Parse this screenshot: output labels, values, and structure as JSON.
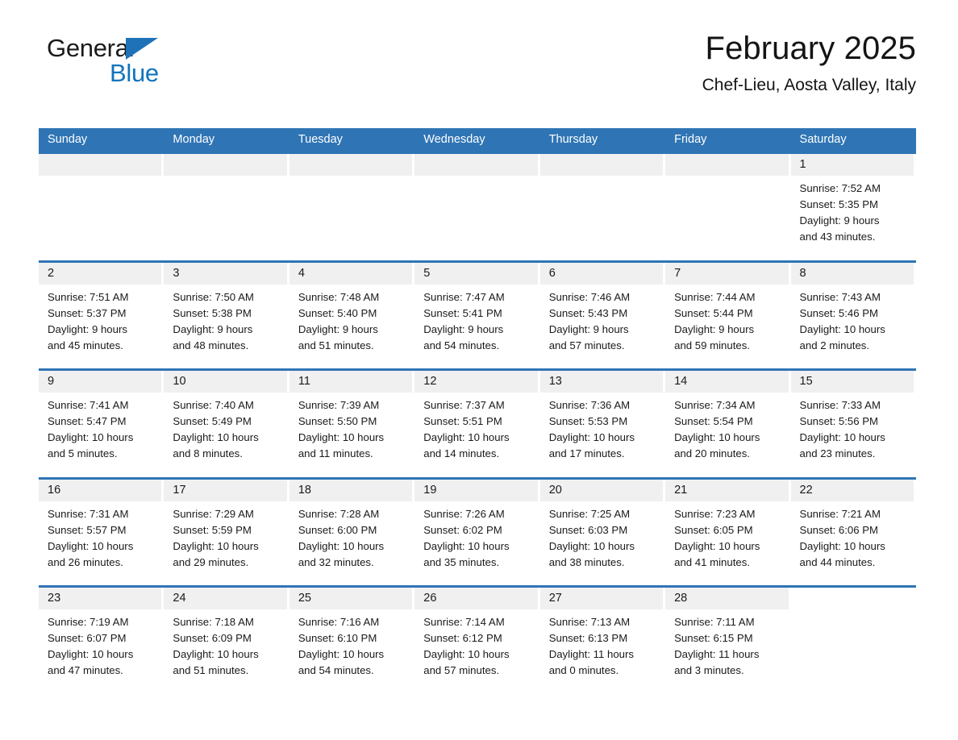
{
  "brand": {
    "name_part1": "General",
    "name_part2": "Blue",
    "triangle_color": "#1f72b8",
    "blue_color": "#1274bd"
  },
  "header": {
    "title": "February 2025",
    "subtitle": "Chef-Lieu, Aosta Valley, Italy",
    "accent_color": "#2f75b5",
    "band_color": "#f0f0f0"
  },
  "weekdays": [
    "Sunday",
    "Monday",
    "Tuesday",
    "Wednesday",
    "Thursday",
    "Friday",
    "Saturday"
  ],
  "weeks": [
    [
      {
        "day": "",
        "sunrise": "",
        "sunset": "",
        "daylight_1": "",
        "daylight_2": ""
      },
      {
        "day": "",
        "sunrise": "",
        "sunset": "",
        "daylight_1": "",
        "daylight_2": ""
      },
      {
        "day": "",
        "sunrise": "",
        "sunset": "",
        "daylight_1": "",
        "daylight_2": ""
      },
      {
        "day": "",
        "sunrise": "",
        "sunset": "",
        "daylight_1": "",
        "daylight_2": ""
      },
      {
        "day": "",
        "sunrise": "",
        "sunset": "",
        "daylight_1": "",
        "daylight_2": ""
      },
      {
        "day": "",
        "sunrise": "",
        "sunset": "",
        "daylight_1": "",
        "daylight_2": ""
      },
      {
        "day": "1",
        "sunrise": "Sunrise: 7:52 AM",
        "sunset": "Sunset: 5:35 PM",
        "daylight_1": "Daylight: 9 hours",
        "daylight_2": "and 43 minutes."
      }
    ],
    [
      {
        "day": "2",
        "sunrise": "Sunrise: 7:51 AM",
        "sunset": "Sunset: 5:37 PM",
        "daylight_1": "Daylight: 9 hours",
        "daylight_2": "and 45 minutes."
      },
      {
        "day": "3",
        "sunrise": "Sunrise: 7:50 AM",
        "sunset": "Sunset: 5:38 PM",
        "daylight_1": "Daylight: 9 hours",
        "daylight_2": "and 48 minutes."
      },
      {
        "day": "4",
        "sunrise": "Sunrise: 7:48 AM",
        "sunset": "Sunset: 5:40 PM",
        "daylight_1": "Daylight: 9 hours",
        "daylight_2": "and 51 minutes."
      },
      {
        "day": "5",
        "sunrise": "Sunrise: 7:47 AM",
        "sunset": "Sunset: 5:41 PM",
        "daylight_1": "Daylight: 9 hours",
        "daylight_2": "and 54 minutes."
      },
      {
        "day": "6",
        "sunrise": "Sunrise: 7:46 AM",
        "sunset": "Sunset: 5:43 PM",
        "daylight_1": "Daylight: 9 hours",
        "daylight_2": "and 57 minutes."
      },
      {
        "day": "7",
        "sunrise": "Sunrise: 7:44 AM",
        "sunset": "Sunset: 5:44 PM",
        "daylight_1": "Daylight: 9 hours",
        "daylight_2": "and 59 minutes."
      },
      {
        "day": "8",
        "sunrise": "Sunrise: 7:43 AM",
        "sunset": "Sunset: 5:46 PM",
        "daylight_1": "Daylight: 10 hours",
        "daylight_2": "and 2 minutes."
      }
    ],
    [
      {
        "day": "9",
        "sunrise": "Sunrise: 7:41 AM",
        "sunset": "Sunset: 5:47 PM",
        "daylight_1": "Daylight: 10 hours",
        "daylight_2": "and 5 minutes."
      },
      {
        "day": "10",
        "sunrise": "Sunrise: 7:40 AM",
        "sunset": "Sunset: 5:49 PM",
        "daylight_1": "Daylight: 10 hours",
        "daylight_2": "and 8 minutes."
      },
      {
        "day": "11",
        "sunrise": "Sunrise: 7:39 AM",
        "sunset": "Sunset: 5:50 PM",
        "daylight_1": "Daylight: 10 hours",
        "daylight_2": "and 11 minutes."
      },
      {
        "day": "12",
        "sunrise": "Sunrise: 7:37 AM",
        "sunset": "Sunset: 5:51 PM",
        "daylight_1": "Daylight: 10 hours",
        "daylight_2": "and 14 minutes."
      },
      {
        "day": "13",
        "sunrise": "Sunrise: 7:36 AM",
        "sunset": "Sunset: 5:53 PM",
        "daylight_1": "Daylight: 10 hours",
        "daylight_2": "and 17 minutes."
      },
      {
        "day": "14",
        "sunrise": "Sunrise: 7:34 AM",
        "sunset": "Sunset: 5:54 PM",
        "daylight_1": "Daylight: 10 hours",
        "daylight_2": "and 20 minutes."
      },
      {
        "day": "15",
        "sunrise": "Sunrise: 7:33 AM",
        "sunset": "Sunset: 5:56 PM",
        "daylight_1": "Daylight: 10 hours",
        "daylight_2": "and 23 minutes."
      }
    ],
    [
      {
        "day": "16",
        "sunrise": "Sunrise: 7:31 AM",
        "sunset": "Sunset: 5:57 PM",
        "daylight_1": "Daylight: 10 hours",
        "daylight_2": "and 26 minutes."
      },
      {
        "day": "17",
        "sunrise": "Sunrise: 7:29 AM",
        "sunset": "Sunset: 5:59 PM",
        "daylight_1": "Daylight: 10 hours",
        "daylight_2": "and 29 minutes."
      },
      {
        "day": "18",
        "sunrise": "Sunrise: 7:28 AM",
        "sunset": "Sunset: 6:00 PM",
        "daylight_1": "Daylight: 10 hours",
        "daylight_2": "and 32 minutes."
      },
      {
        "day": "19",
        "sunrise": "Sunrise: 7:26 AM",
        "sunset": "Sunset: 6:02 PM",
        "daylight_1": "Daylight: 10 hours",
        "daylight_2": "and 35 minutes."
      },
      {
        "day": "20",
        "sunrise": "Sunrise: 7:25 AM",
        "sunset": "Sunset: 6:03 PM",
        "daylight_1": "Daylight: 10 hours",
        "daylight_2": "and 38 minutes."
      },
      {
        "day": "21",
        "sunrise": "Sunrise: 7:23 AM",
        "sunset": "Sunset: 6:05 PM",
        "daylight_1": "Daylight: 10 hours",
        "daylight_2": "and 41 minutes."
      },
      {
        "day": "22",
        "sunrise": "Sunrise: 7:21 AM",
        "sunset": "Sunset: 6:06 PM",
        "daylight_1": "Daylight: 10 hours",
        "daylight_2": "and 44 minutes."
      }
    ],
    [
      {
        "day": "23",
        "sunrise": "Sunrise: 7:19 AM",
        "sunset": "Sunset: 6:07 PM",
        "daylight_1": "Daylight: 10 hours",
        "daylight_2": "and 47 minutes."
      },
      {
        "day": "24",
        "sunrise": "Sunrise: 7:18 AM",
        "sunset": "Sunset: 6:09 PM",
        "daylight_1": "Daylight: 10 hours",
        "daylight_2": "and 51 minutes."
      },
      {
        "day": "25",
        "sunrise": "Sunrise: 7:16 AM",
        "sunset": "Sunset: 6:10 PM",
        "daylight_1": "Daylight: 10 hours",
        "daylight_2": "and 54 minutes."
      },
      {
        "day": "26",
        "sunrise": "Sunrise: 7:14 AM",
        "sunset": "Sunset: 6:12 PM",
        "daylight_1": "Daylight: 10 hours",
        "daylight_2": "and 57 minutes."
      },
      {
        "day": "27",
        "sunrise": "Sunrise: 7:13 AM",
        "sunset": "Sunset: 6:13 PM",
        "daylight_1": "Daylight: 11 hours",
        "daylight_2": "and 0 minutes."
      },
      {
        "day": "28",
        "sunrise": "Sunrise: 7:11 AM",
        "sunset": "Sunset: 6:15 PM",
        "daylight_1": "Daylight: 11 hours",
        "daylight_2": "and 3 minutes."
      },
      {
        "day": "",
        "sunrise": "",
        "sunset": "",
        "daylight_1": "",
        "daylight_2": ""
      }
    ]
  ]
}
